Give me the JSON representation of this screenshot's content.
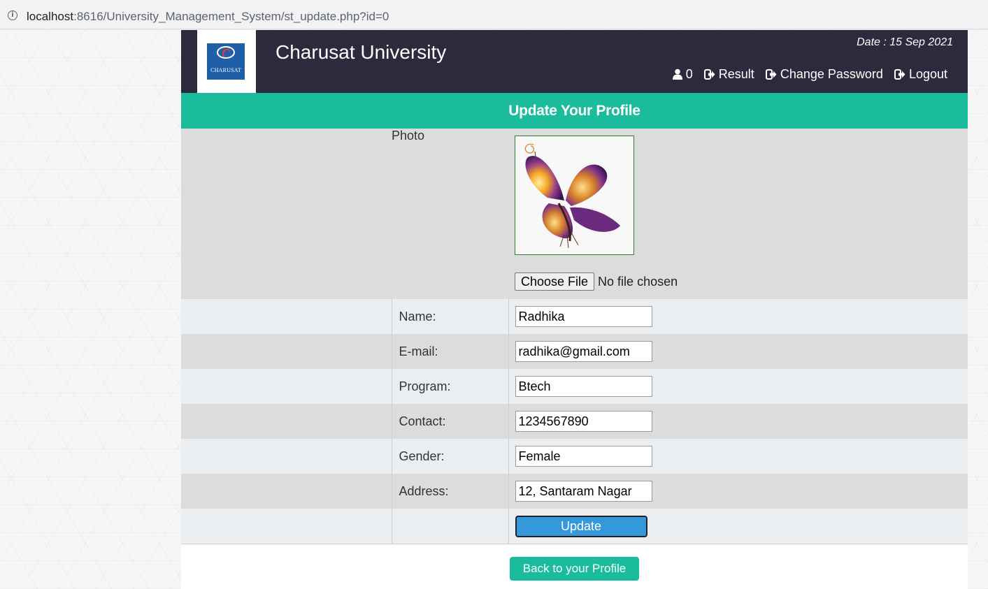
{
  "browser": {
    "url_host": "localhost",
    "url_rest": ":8616/University_Management_System/st_update.php?id=0"
  },
  "header": {
    "logo_text": "CHARUSAT",
    "brand": "Charusat University",
    "date": "Date : 15 Sep 2021",
    "nav": {
      "count": "0",
      "result": "Result",
      "change_password": "Change Password",
      "logout": "Logout"
    }
  },
  "page_title": "Update Your Profile",
  "form": {
    "photo_label": "Photo",
    "file_button": "Choose File",
    "file_status": "No file chosen",
    "fields": [
      {
        "label": "Name:",
        "value": "Radhika"
      },
      {
        "label": "E-mail:",
        "value": "radhika@gmail.com"
      },
      {
        "label": "Program:",
        "value": "Btech"
      },
      {
        "label": "Contact:",
        "value": "1234567890"
      },
      {
        "label": "Gender:",
        "value": "Female"
      },
      {
        "label": "Address:",
        "value": "12, Santaram Nagar"
      }
    ],
    "submit": "Update"
  },
  "back_button": "Back to your Profile",
  "colors": {
    "header_bg": "#2b2b3d",
    "accent": "#1abc9c",
    "update_button": "#3498db"
  }
}
